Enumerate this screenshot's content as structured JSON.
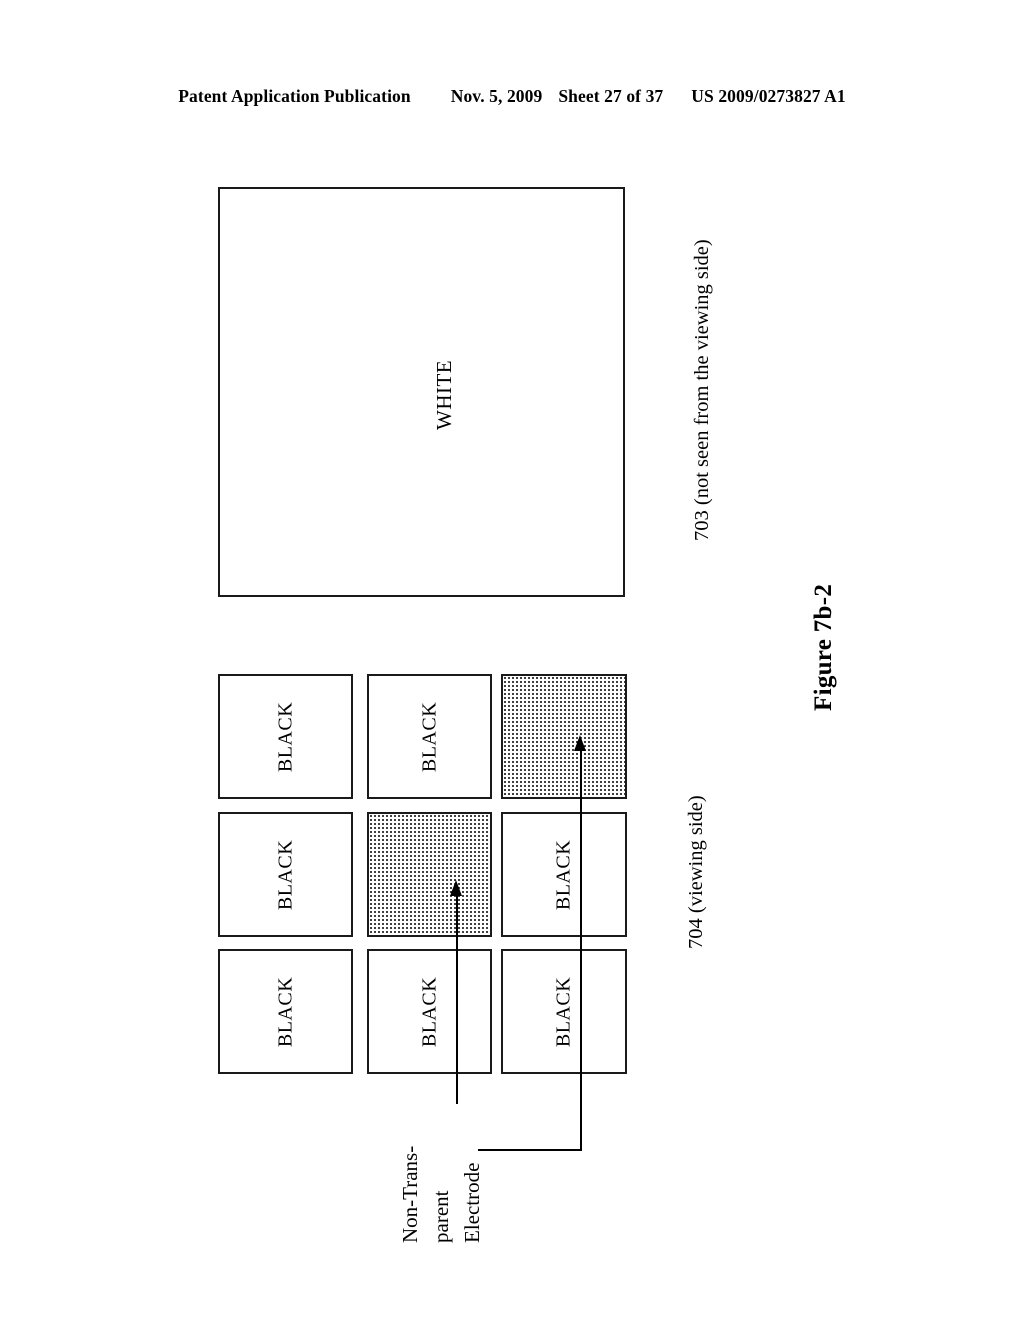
{
  "header": {
    "publication": "Patent Application Publication",
    "date": "Nov. 5, 2009",
    "sheet": "Sheet 27 of 37",
    "patent_number": "US 2009/0273827 A1"
  },
  "figure": {
    "caption": "Figure 7b-2"
  },
  "panels": {
    "back": {
      "label": "WHITE",
      "reference": "703 (not seen from the viewing side)"
    },
    "front": {
      "reference": "704 (viewing side)"
    }
  },
  "grid": {
    "rows": [
      [
        {
          "label": "BLACK",
          "fill": "plain"
        },
        {
          "label": "BLACK",
          "fill": "plain"
        },
        {
          "label": "",
          "fill": "dotted"
        }
      ],
      [
        {
          "label": "BLACK",
          "fill": "plain"
        },
        {
          "label": "",
          "fill": "dotted"
        },
        {
          "label": "BLACK",
          "fill": "plain"
        }
      ],
      [
        {
          "label": "BLACK",
          "fill": "plain"
        },
        {
          "label": "BLACK",
          "fill": "plain"
        },
        {
          "label": "BLACK",
          "fill": "plain"
        }
      ]
    ]
  },
  "annotations": {
    "electrode": {
      "line1": "Non-Trans-",
      "line2": "parent",
      "line3": "Electrode"
    }
  },
  "colors": {
    "ink": "#000000",
    "line": "#1a1a1a",
    "paper": "#ffffff"
  }
}
